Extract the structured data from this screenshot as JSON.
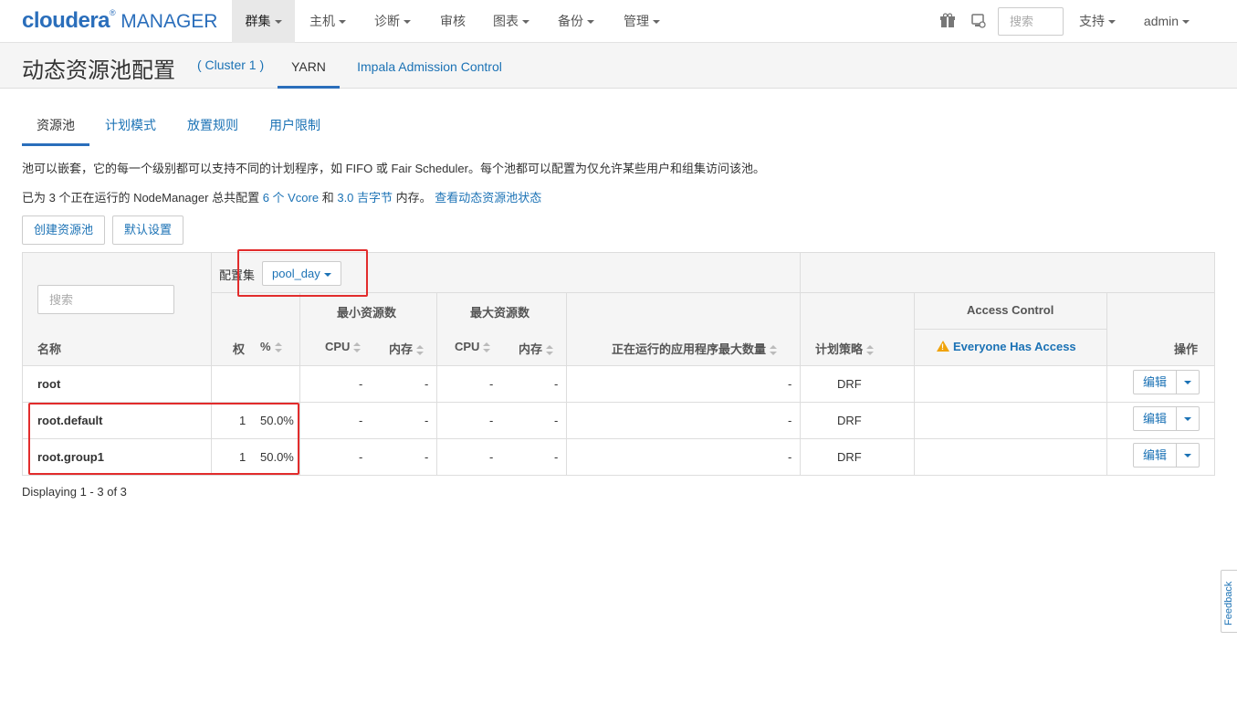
{
  "brand": {
    "name": "cloudera",
    "reg": "®",
    "product": "MANAGER"
  },
  "nav": {
    "items": [
      {
        "label": "群集",
        "dropdown": true,
        "active": true
      },
      {
        "label": "主机",
        "dropdown": true
      },
      {
        "label": "诊断",
        "dropdown": true
      },
      {
        "label": "审核",
        "dropdown": false
      },
      {
        "label": "图表",
        "dropdown": true
      },
      {
        "label": "备份",
        "dropdown": true
      },
      {
        "label": "管理",
        "dropdown": true
      }
    ],
    "search_placeholder": "搜索",
    "support_label": "支持",
    "user_label": "admin"
  },
  "subheader": {
    "title": "动态资源池配置",
    "cluster": "( Cluster 1 )",
    "tabs": [
      "YARN",
      "Impala Admission Control"
    ]
  },
  "tabs": [
    "资源池",
    "计划模式",
    "放置规则",
    "用户限制"
  ],
  "description": {
    "line1": "池可以嵌套，它的每一个级别都可以支持不同的计划程序，如 FIFO 或 Fair Scheduler。每个池都可以配置为仅允许某些用户和组集访问该池。",
    "line2_prefix": "已为 3 个正在运行的 NodeManager 总共配置 ",
    "line2_vcore": "6 个 Vcore",
    "line2_and": " 和 ",
    "line2_mem": "3.0 吉字节",
    "line2_suffix": " 内存。 ",
    "line2_link": "查看动态资源池状态"
  },
  "buttons": {
    "create": "创建资源池",
    "defaults": "默认设置"
  },
  "table": {
    "config_set_label": "配置集",
    "config_set_value": "pool_day",
    "search_placeholder": "搜索",
    "headers": {
      "name": "名称",
      "weight": "权",
      "percent": "%",
      "min_resources": "最小资源数",
      "max_resources": "最大资源数",
      "cpu": "CPU",
      "memory": "内存",
      "max_running_apps": "正在运行的应用程序最大数量",
      "policy": "计划策略",
      "access_control": "Access Control",
      "access_value": "Everyone Has Access",
      "actions": "操作"
    },
    "rows": [
      {
        "name": "root",
        "weight": "",
        "percent": "",
        "min_cpu": "-",
        "min_mem": "-",
        "max_cpu": "-",
        "max_mem": "-",
        "max_apps": "-",
        "policy": "DRF",
        "edit": "编辑"
      },
      {
        "name": "root.default",
        "weight": "1",
        "percent": "50.0%",
        "min_cpu": "-",
        "min_mem": "-",
        "max_cpu": "-",
        "max_mem": "-",
        "max_apps": "-",
        "policy": "DRF",
        "edit": "编辑"
      },
      {
        "name": "root.group1",
        "weight": "1",
        "percent": "50.0%",
        "min_cpu": "-",
        "min_mem": "-",
        "max_cpu": "-",
        "max_mem": "-",
        "max_apps": "-",
        "policy": "DRF",
        "edit": "编辑"
      }
    ],
    "footer": "Displaying 1 - 3 of 3"
  },
  "feedback": "Feedback",
  "colors": {
    "accent": "#2a6ebb",
    "link": "#1b72b5",
    "highlight": "#e22c2c",
    "warning": "#f0a30a"
  }
}
